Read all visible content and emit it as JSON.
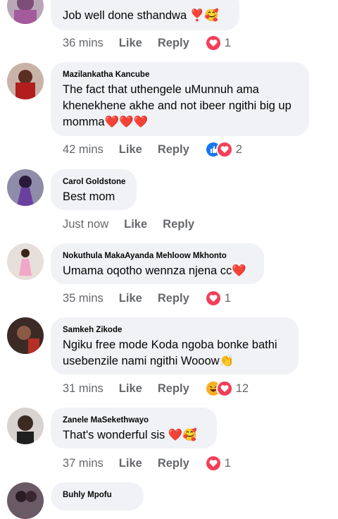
{
  "comments": [
    {
      "author": "",
      "text": "Job well done sthandwa ❣️🥰",
      "time": "36 mins",
      "like": "Like",
      "reply": "Reply",
      "reactions": [
        "love"
      ],
      "reaction_count": "1"
    },
    {
      "author": "Mazilankatha Kancube",
      "text": "The fact that uthengele uMunnuh ama khenekhene akhe and not ibeer ngithi big up momma❤️❤️❤️",
      "time": "42 mins",
      "like": "Like",
      "reply": "Reply",
      "reactions": [
        "like",
        "love"
      ],
      "reaction_count": "2"
    },
    {
      "author": "Carol Goldstone",
      "text": "Best mom",
      "time": "Just now",
      "like": "Like",
      "reply": "Reply",
      "reactions": [],
      "reaction_count": ""
    },
    {
      "author": "Nokuthula MakaAyanda Mehloow Mkhonto",
      "text": "Umama oqotho wennza njena cc❤️",
      "time": "35 mins",
      "like": "Like",
      "reply": "Reply",
      "reactions": [
        "love"
      ],
      "reaction_count": "1"
    },
    {
      "author": "Samkeh Zikode",
      "text": "Ngiku free mode Koda ngoba bonke bathi usebenzile nami ngithi Wooow👏",
      "time": "31 mins",
      "like": "Like",
      "reply": "Reply",
      "reactions": [
        "haha",
        "love"
      ],
      "reaction_count": "12"
    },
    {
      "author": "Zanele MaSekethwayo",
      "text": "That's wonderful sis ❤️🥰",
      "time": "37 mins",
      "like": "Like",
      "reply": "Reply",
      "reactions": [
        "love"
      ],
      "reaction_count": "1"
    },
    {
      "author": "Buhly Mpofu",
      "text": "",
      "time": "",
      "like": "",
      "reply": "",
      "reactions": [],
      "reaction_count": ""
    }
  ],
  "colors": {
    "bubble": "#f0f2f5",
    "secondary_text": "#65676b",
    "like_blue": "#1877f2",
    "love_red": "#f33e58",
    "haha_yellow": "#f7b125"
  }
}
